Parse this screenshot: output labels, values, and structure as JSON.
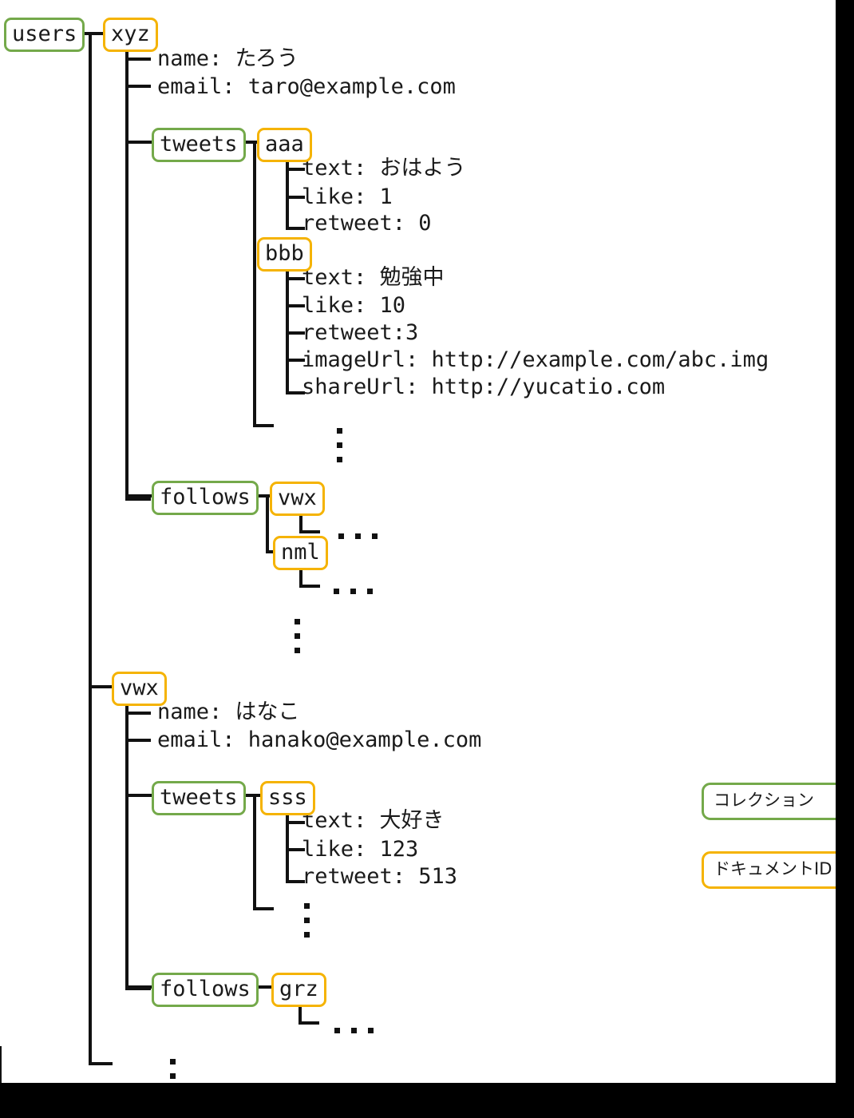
{
  "diagram": {
    "root": {
      "label": "users",
      "kind": "collection"
    },
    "legend": [
      {
        "label": "コレクション",
        "kind": "collection",
        "color": "#74a94a"
      },
      {
        "label": "ドキュメントID",
        "kind": "docid",
        "color": "#f5b301"
      }
    ],
    "users": [
      {
        "id": "xyz",
        "fields": [
          {
            "text": "name: たろう"
          },
          {
            "text": "email: taro@example.com"
          }
        ],
        "subcollections": [
          {
            "label": "tweets",
            "docs": [
              {
                "id": "aaa",
                "fields": [
                  {
                    "text": "text: おはよう"
                  },
                  {
                    "text": "like: 1"
                  },
                  {
                    "text": "retweet: 0"
                  }
                ]
              },
              {
                "id": "bbb",
                "fields": [
                  {
                    "text": "text: 勉強中"
                  },
                  {
                    "text": "like: 10"
                  },
                  {
                    "text": "retweet:3"
                  },
                  {
                    "text": "imageUrl: http://example.com/abc.img"
                  },
                  {
                    "text": "shareUrl: http://yucatio.com"
                  }
                ]
              }
            ]
          },
          {
            "label": "follows",
            "docs": [
              {
                "id": "vwx",
                "fields": []
              },
              {
                "id": "nml",
                "fields": []
              }
            ]
          }
        ]
      },
      {
        "id": "vwx",
        "fields": [
          {
            "text": "name: はなこ"
          },
          {
            "text": "email: hanako@example.com"
          }
        ],
        "subcollections": [
          {
            "label": "tweets",
            "docs": [
              {
                "id": "sss",
                "fields": [
                  {
                    "text": "text: 大好き"
                  },
                  {
                    "text": "like: 123"
                  },
                  {
                    "text": "retweet: 513"
                  }
                ]
              }
            ]
          },
          {
            "label": "follows",
            "docs": [
              {
                "id": "grz",
                "fields": []
              }
            ]
          }
        ]
      }
    ],
    "labels": {
      "tweets": "tweets",
      "follows": "follows",
      "doc_aaa": "aaa",
      "doc_bbb": "bbb",
      "doc_sss": "sss",
      "doc_vwx_follow": "vwx",
      "doc_nml": "nml",
      "doc_grz": "grz",
      "user_xyz": "xyz",
      "user_vwx": "vwx"
    },
    "ellipsis": "…"
  }
}
